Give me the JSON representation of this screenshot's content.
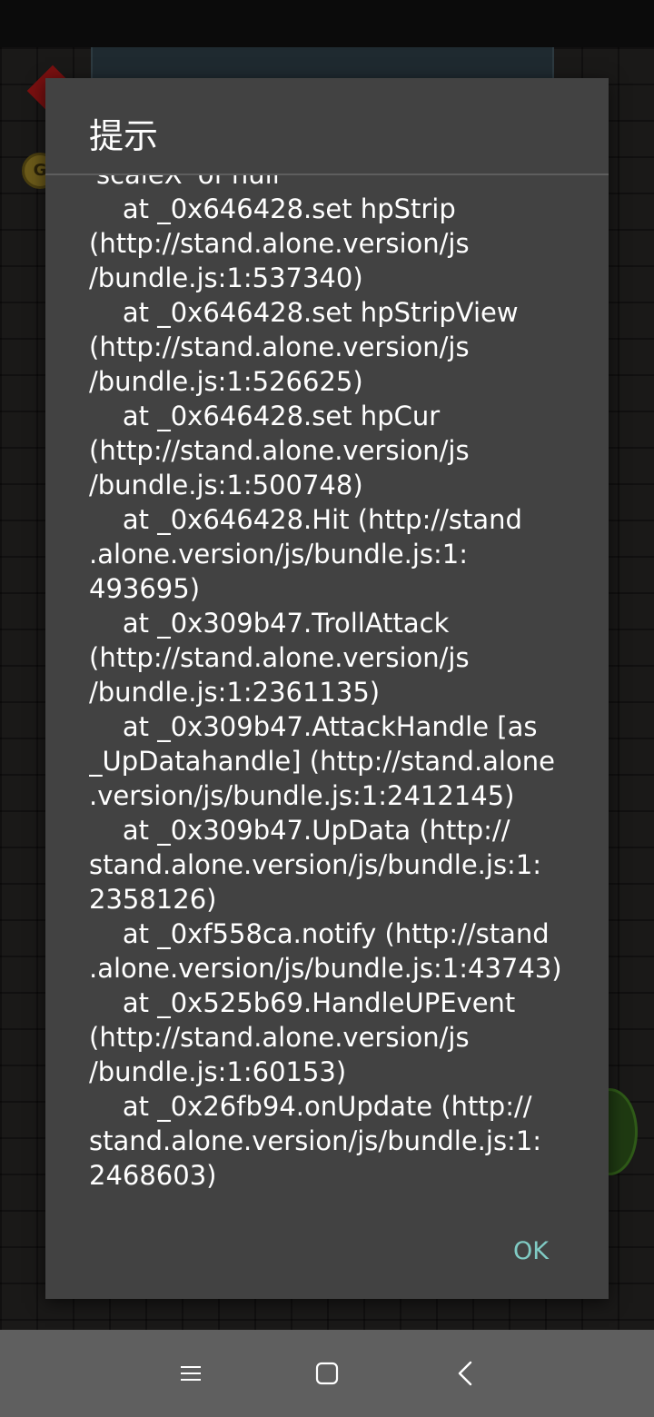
{
  "dialog": {
    "title": "提示",
    "message": "'scaleX' of null\n    at _0x646428.set hpStrip\n(http://stand.alone.version/js\n/bundle.js:1:537340)\n    at _0x646428.set hpStripView\n(http://stand.alone.version/js\n/bundle.js:1:526625)\n    at _0x646428.set hpCur\n(http://stand.alone.version/js\n/bundle.js:1:500748)\n    at _0x646428.Hit (http://stand\n.alone.version/js/bundle.js:1:\n493695)\n    at _0x309b47.TrollAttack\n(http://stand.alone.version/js\n/bundle.js:1:2361135)\n    at _0x309b47.AttackHandle [as\n_UpDatahandle] (http://stand.alone\n.version/js/bundle.js:1:2412145)\n    at _0x309b47.UpData (http://\nstand.alone.version/js/bundle.js:1:\n2358126)\n    at _0xf558ca.notify (http://stand\n.alone.version/js/bundle.js:1:43743)\n    at _0x525b69.HandleUPEvent\n(http://stand.alone.version/js\n/bundle.js:1:60153)\n    at _0x26fb94.onUpdate (http://\nstand.alone.version/js/bundle.js:1:\n2468603)",
    "ok_label": "OK"
  },
  "background": {
    "coin_letter": "G"
  },
  "nav_bar": {
    "icons": [
      "menu-icon",
      "home-square-icon",
      "back-chevron-icon"
    ]
  },
  "colors": {
    "dialog_bg": "#424242",
    "ok_accent": "#80cbc4",
    "nav_bar_bg": "#5f5f5f"
  }
}
